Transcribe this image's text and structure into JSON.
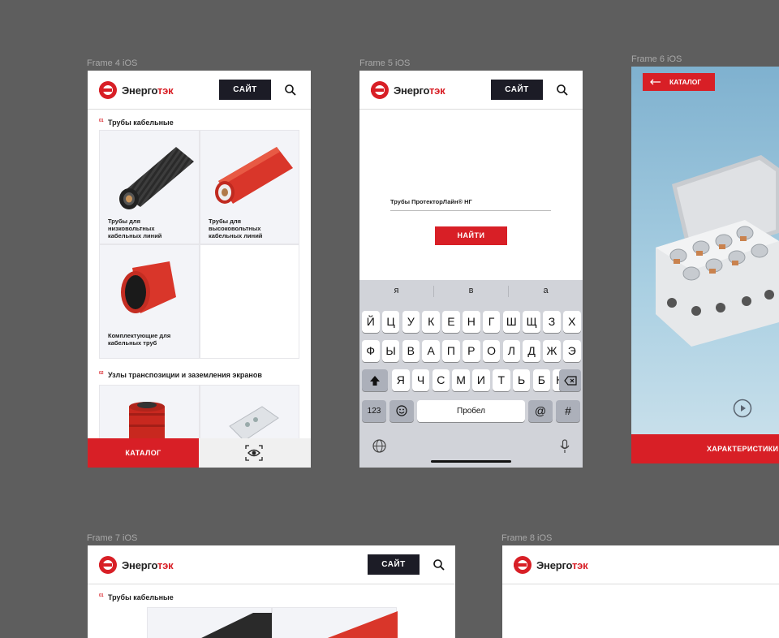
{
  "frames": {
    "f4": {
      "label": "Frame 4 iOS"
    },
    "f5": {
      "label": "Frame 5 iOS"
    },
    "f6": {
      "label": "Frame 6 iOS"
    },
    "f7": {
      "label": "Frame 7 iOS"
    },
    "f8": {
      "label": "Frame 8 iOS"
    }
  },
  "brand": {
    "name_a": "Энерго",
    "name_b": "тэк",
    "accent": "#d81f26",
    "dark": "#1c1c26"
  },
  "header": {
    "site_label": "САЙТ",
    "search_icon": "search-icon"
  },
  "catalog": {
    "sections": [
      {
        "num": "01",
        "title": "Трубы кабельные"
      },
      {
        "num": "02",
        "title": "Узлы транспозиции и заземления экранов"
      }
    ],
    "cards": [
      {
        "caption": "Трубы для низковольтных кабельных линий"
      },
      {
        "caption": "Трубы для высоковольтных кабельных линий"
      },
      {
        "caption": "Комплектующие для кабельных труб"
      }
    ],
    "bottom_catalog": "КАТАЛОГ",
    "ar_icon": "eye-scan-icon"
  },
  "search": {
    "value": "Трубы ПротекторЛайн® НГ",
    "find_label": "НАЙТИ",
    "suggestions": [
      "я",
      "в",
      "а"
    ],
    "rows": [
      [
        "й",
        "ц",
        "у",
        "к",
        "е",
        "н",
        "г",
        "ш",
        "щ",
        "з",
        "х"
      ],
      [
        "ф",
        "ы",
        "в",
        "а",
        "п",
        "р",
        "о",
        "л",
        "д",
        "ж",
        "э"
      ],
      [
        "я",
        "ч",
        "с",
        "м",
        "и",
        "т",
        "ь",
        "б",
        "ю"
      ]
    ],
    "key_123": "123",
    "key_space": "Пробел",
    "key_at": "@",
    "key_hash": "#"
  },
  "product": {
    "back_label": "КАТАЛОГ",
    "char_label": "ХАРАКТЕРИСТИКИ"
  }
}
